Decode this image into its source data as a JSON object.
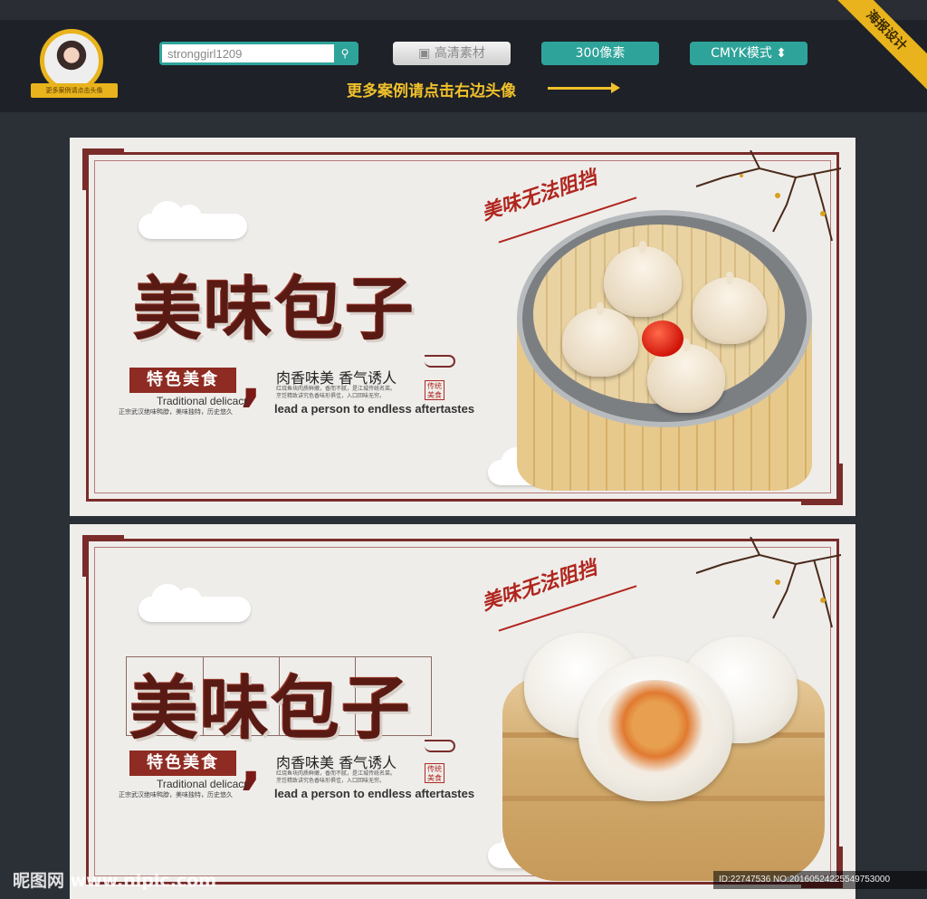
{
  "header": {
    "search": {
      "value": "stronggirl1209"
    },
    "search_icon": "search-icon",
    "btn_hd": "高清素材",
    "btn_300": "300像素",
    "btn_cmyk": "CMYK模式",
    "more_text": "更多案例请点击右边头像",
    "corner_badge": "海报设计",
    "avatar_ribbon": "更多案例请点击头像"
  },
  "poster1": {
    "title": "美味包子",
    "tag": "特色美食",
    "tag_en": "Traditional delicacy",
    "small_note": "正宗武汉绝味鸭脖，美味独特，历史悠久",
    "slogan": "肉香味美 香气诱人",
    "slogan_en": "lead a person to endless aftertastes",
    "seal": "传统美食",
    "brush": "美味无法阻挡"
  },
  "poster2": {
    "title": "美味包子",
    "tag": "特色美食",
    "tag_en": "Traditional delicacy",
    "small_note": "正宗武汉绝味鸭脖，美味独特，历史悠久",
    "slogan": "肉香味美 香气诱人",
    "slogan_en": "lead a person to endless aftertastes",
    "seal": "传统美食",
    "brush": "美味无法阻挡"
  },
  "footer": {
    "watermark": "昵图网 www.nipic.com",
    "id_strip": "ID:22747536 NO:20160524225549753000"
  },
  "colors": {
    "accent_teal": "#2ea39a",
    "accent_gold": "#e8b31c",
    "frame_red": "#7a2c2a",
    "tag_red": "#8e2b22"
  }
}
